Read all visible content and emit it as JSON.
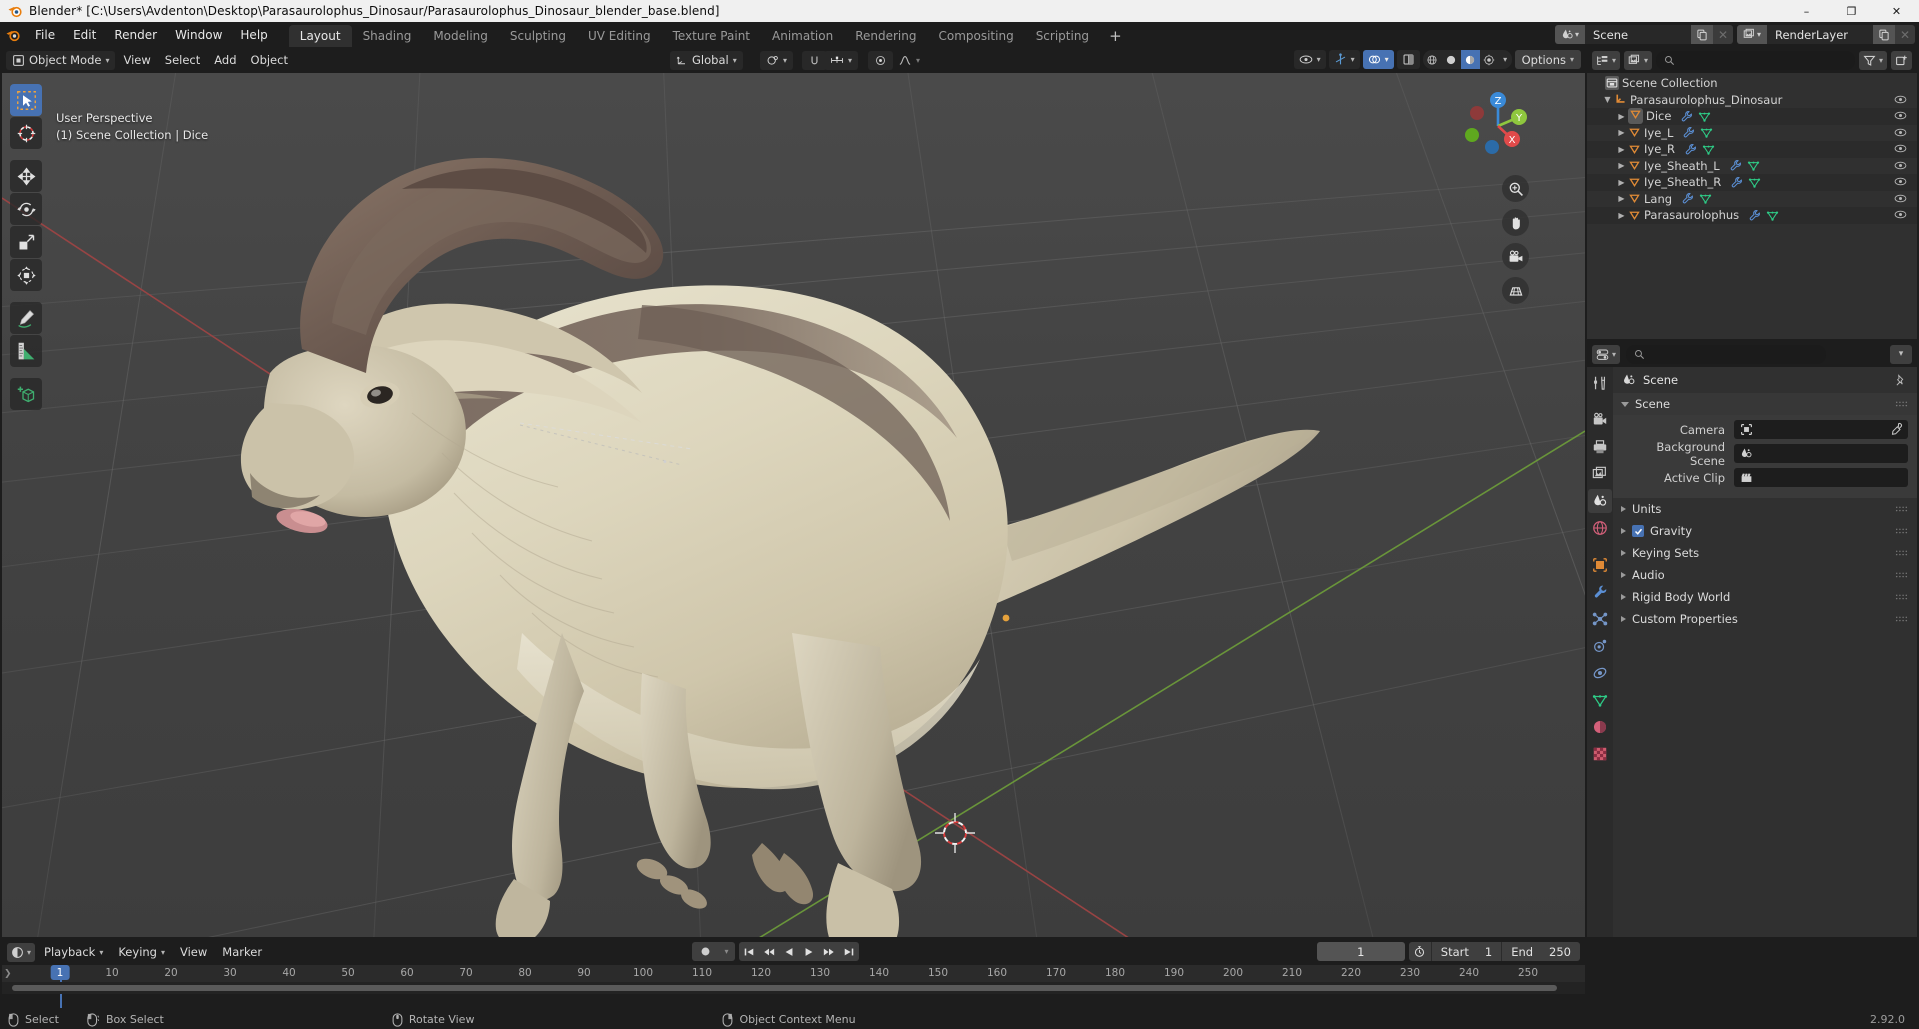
{
  "window": {
    "title": "Blender* [C:\\Users\\Avdenton\\Desktop\\Parasaurolophus_Dinosaur/Parasaurolophus_Dinosaur_blender_base.blend]",
    "minimize": "–",
    "maximize": "❐",
    "close": "✕"
  },
  "topbar": {
    "menus": [
      "File",
      "Edit",
      "Render",
      "Window",
      "Help"
    ],
    "workspaces": [
      {
        "label": "Layout",
        "active": true
      },
      {
        "label": "Shading",
        "active": false
      },
      {
        "label": "Modeling",
        "active": false
      },
      {
        "label": "Sculpting",
        "active": false
      },
      {
        "label": "UV Editing",
        "active": false
      },
      {
        "label": "Texture Paint",
        "active": false
      },
      {
        "label": "Animation",
        "active": false
      },
      {
        "label": "Rendering",
        "active": false
      },
      {
        "label": "Compositing",
        "active": false
      },
      {
        "label": "Scripting",
        "active": false
      }
    ],
    "add_workspace": "+",
    "scene_name": "Scene",
    "viewlayer_name": "RenderLayer"
  },
  "viewport": {
    "mode": "Object Mode",
    "menus": [
      "View",
      "Select",
      "Add",
      "Object"
    ],
    "transform_orientation": "Global",
    "overlay_line1": "User Perspective",
    "overlay_line2": "(1) Scene Collection | Dice",
    "options_label": "Options",
    "gizmo_axes": [
      "X",
      "Y",
      "Z"
    ],
    "tools": [
      "tweak-select-tool",
      "cursor-tool",
      "move-tool",
      "rotate-tool",
      "scale-tool",
      "transform-tool",
      "annotate-tool",
      "measure-tool",
      "add-cube-tool"
    ],
    "nav_buttons": [
      "zoom-icon",
      "pan-hand-icon",
      "camera-view-icon",
      "toggle-ortho-icon"
    ]
  },
  "outliner": {
    "search_placeholder": "",
    "root": "Scene Collection",
    "items": [
      {
        "label": "Parasaurolophus_Dinosaur",
        "level": 0,
        "type": "collection",
        "expanded": true,
        "modifier": false,
        "mesh": false
      },
      {
        "label": "Dice",
        "level": 1,
        "type": "object",
        "expanded": false,
        "modifier": true,
        "mesh": true,
        "selected": true
      },
      {
        "label": "Iye_L",
        "level": 1,
        "type": "object",
        "expanded": false,
        "modifier": true,
        "mesh": true,
        "selected": false
      },
      {
        "label": "Iye_R",
        "level": 1,
        "type": "object",
        "expanded": false,
        "modifier": true,
        "mesh": true,
        "selected": false
      },
      {
        "label": "Iye_Sheath_L",
        "level": 1,
        "type": "object",
        "expanded": false,
        "modifier": true,
        "mesh": true,
        "selected": false
      },
      {
        "label": "Iye_Sheath_R",
        "level": 1,
        "type": "object",
        "expanded": false,
        "modifier": true,
        "mesh": true,
        "selected": false
      },
      {
        "label": "Lang",
        "level": 1,
        "type": "object",
        "expanded": false,
        "modifier": true,
        "mesh": true,
        "selected": false
      },
      {
        "label": "Parasaurolophus",
        "level": 1,
        "type": "object",
        "expanded": false,
        "modifier": true,
        "mesh": true,
        "selected": false
      }
    ]
  },
  "properties": {
    "breadcrumb": "Scene",
    "panels": [
      {
        "label": "Scene",
        "open": true,
        "checkbox": false
      },
      {
        "label": "Units",
        "open": false,
        "checkbox": false
      },
      {
        "label": "Gravity",
        "open": false,
        "checkbox": true
      },
      {
        "label": "Keying Sets",
        "open": false,
        "checkbox": false
      },
      {
        "label": "Audio",
        "open": false,
        "checkbox": false
      },
      {
        "label": "Rigid Body World",
        "open": false,
        "checkbox": false
      },
      {
        "label": "Custom Properties",
        "open": false,
        "checkbox": false
      }
    ],
    "fields": [
      {
        "label": "Camera",
        "value": "",
        "icon": "camera-object-icon",
        "eyedropper": true
      },
      {
        "label": "Background Scene",
        "value": "",
        "icon": "scene-icon",
        "eyedropper": false
      },
      {
        "label": "Active Clip",
        "value": "",
        "icon": "clip-icon",
        "eyedropper": false
      }
    ],
    "tabs": [
      "tool-icon",
      "render-icon",
      "output-icon",
      "view-layer-icon",
      "scene-icon",
      "world-icon",
      "object-icon",
      "modifier-icon",
      "particles-icon",
      "physics-icon",
      "constraints-icon",
      "data-icon",
      "material-icon",
      "texture-icon"
    ]
  },
  "timeline": {
    "menus": [
      "View",
      "Marker"
    ],
    "playback_label": "Playback",
    "keying_label": "Keying",
    "current_frame": "1",
    "start_label": "Start",
    "start_value": "1",
    "end_label": "End",
    "end_value": "250",
    "ticks": [
      "1",
      "10",
      "20",
      "30",
      "40",
      "50",
      "60",
      "70",
      "80",
      "90",
      "100",
      "110",
      "120",
      "130",
      "140",
      "150",
      "160",
      "170",
      "180",
      "190",
      "200",
      "210",
      "220",
      "230",
      "240",
      "250"
    ],
    "playhead_frame": "1"
  },
  "statusbar": {
    "items": [
      {
        "icon": "mouse-left-icon",
        "label": "Select"
      },
      {
        "icon": "mouse-drag-icon",
        "label": "Box Select"
      },
      {
        "icon": "mouse-middle-icon",
        "label": "Rotate View"
      },
      {
        "icon": "mouse-right-icon",
        "label": "Object Context Menu"
      }
    ],
    "version": "2.92.0"
  },
  "colors": {
    "accent_blue": "#4772b3",
    "orange": "#ed8a20",
    "mesh_green": "#2ecc87",
    "modifier_blue": "#5b8fd4",
    "axis_x": "#e04a4a",
    "axis_y": "#8fc73e",
    "axis_z": "#3a8ad8"
  }
}
